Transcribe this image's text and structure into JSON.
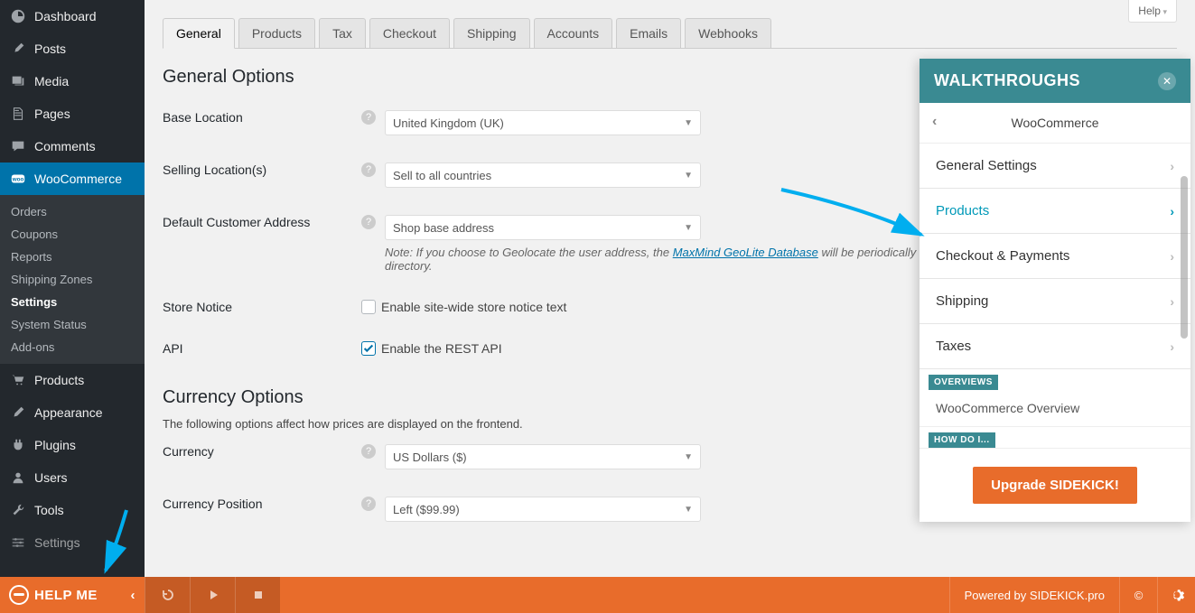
{
  "help_tab": "Help",
  "sidebar": {
    "items": [
      {
        "label": "Dashboard",
        "icon": "dashboard"
      },
      {
        "label": "Posts",
        "icon": "pin"
      },
      {
        "label": "Media",
        "icon": "media"
      },
      {
        "label": "Pages",
        "icon": "page"
      },
      {
        "label": "Comments",
        "icon": "comment"
      },
      {
        "label": "WooCommerce",
        "icon": "woo",
        "current": true
      },
      {
        "label": "Products",
        "icon": "cart"
      },
      {
        "label": "Appearance",
        "icon": "brush"
      },
      {
        "label": "Plugins",
        "icon": "plug"
      },
      {
        "label": "Users",
        "icon": "user"
      },
      {
        "label": "Tools",
        "icon": "wrench"
      },
      {
        "label": "Settings",
        "icon": "sliders"
      }
    ],
    "submenu": [
      "Orders",
      "Coupons",
      "Reports",
      "Shipping Zones",
      "Settings",
      "System Status",
      "Add-ons"
    ],
    "submenu_current": "Settings"
  },
  "tabs": [
    "General",
    "Products",
    "Tax",
    "Checkout",
    "Shipping",
    "Accounts",
    "Emails",
    "Webhooks"
  ],
  "active_tab": "General",
  "sections": {
    "general": {
      "title": "General Options",
      "base_location": {
        "label": "Base Location",
        "value": "United Kingdom (UK)"
      },
      "selling_locations": {
        "label": "Selling Location(s)",
        "value": "Sell to all countries"
      },
      "default_customer_address": {
        "label": "Default Customer Address",
        "value": "Shop base address",
        "note_prefix": "Note: If you choose to Geolocate the user address, the ",
        "note_link": "MaxMind GeoLite Database",
        "note_suffix": " will be periodically downloaded and stored in your wp-content directory."
      },
      "store_notice": {
        "label": "Store Notice",
        "checkbox_label": "Enable site-wide store notice text",
        "checked": false
      },
      "api": {
        "label": "API",
        "checkbox_label": "Enable the REST API",
        "checked": true
      }
    },
    "currency": {
      "title": "Currency Options",
      "desc": "The following options affect how prices are displayed on the frontend.",
      "currency": {
        "label": "Currency",
        "value": "US Dollars ($)"
      },
      "position": {
        "label": "Currency Position",
        "value": "Left ($99.99)"
      }
    }
  },
  "walkthrough": {
    "title": "WALKTHROUGHS",
    "nav_title": "WooCommerce",
    "categories": [
      {
        "label": "General Settings"
      },
      {
        "label": "Products",
        "active": true
      },
      {
        "label": "Checkout & Payments"
      },
      {
        "label": "Shipping"
      },
      {
        "label": "Taxes"
      }
    ],
    "overviews_tag": "OVERVIEWS",
    "overview_item": "WooCommerce Overview",
    "howdoi_tag": "HOW DO I...",
    "upgrade": "Upgrade SIDEKICK!"
  },
  "bottombar": {
    "helpme": "HELP ME",
    "powered": "Powered by SIDEKICK.pro"
  }
}
